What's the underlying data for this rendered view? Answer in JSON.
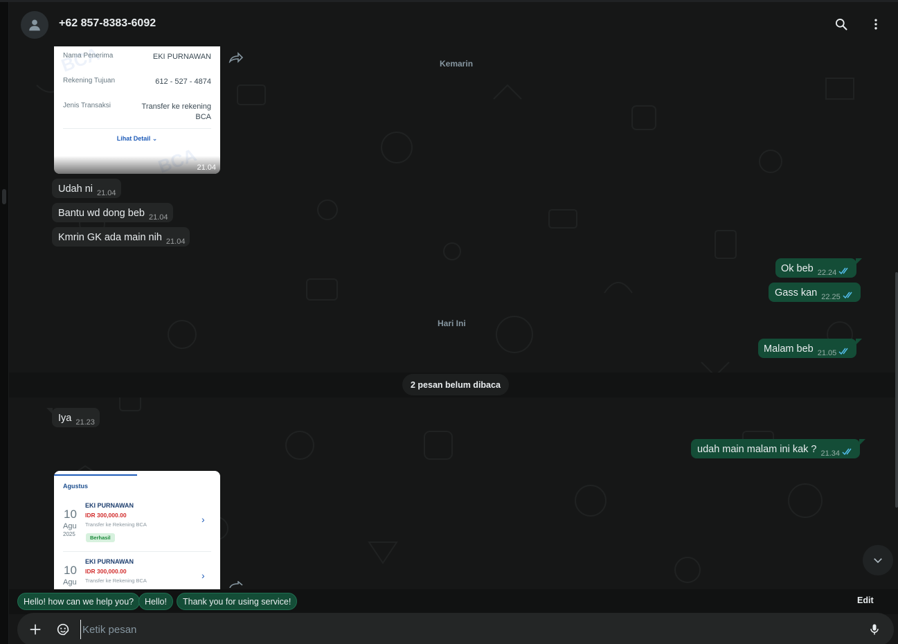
{
  "header": {
    "contact": "+62 857-8383-6092",
    "search_icon": "search-icon",
    "menu_icon": "more-vert-icon"
  },
  "receipt1": {
    "rows": [
      {
        "label": "Nama Penerima",
        "value": "EKI PURNAWAN"
      },
      {
        "label": "Rekening Tujuan",
        "value": "612 - 527 - 4874"
      },
      {
        "label": "Jenis Transaksi",
        "value_line1": "Transfer ke rekening",
        "value_line2": "BCA"
      }
    ],
    "detail_link": "Lihat Detail",
    "watermark": "BCA",
    "time": "21.04"
  },
  "dividers": {
    "yesterday": "Kemarin",
    "today": "Hari Ini",
    "unread": "2 pesan belum dibaca"
  },
  "messages": [
    {
      "dir": "in",
      "text": "Udah ni",
      "time": "21.04"
    },
    {
      "dir": "in",
      "text": "Bantu wd dong beb",
      "time": "21.04"
    },
    {
      "dir": "in",
      "text": "Kmrin GK ada main nih",
      "time": "21.04"
    },
    {
      "dir": "out",
      "text": "Ok beb",
      "time": "22.24",
      "status": "read"
    },
    {
      "dir": "out",
      "text": "Gass kan",
      "time": "22.25",
      "status": "read"
    },
    {
      "dir": "out",
      "text": "Malam beb",
      "time": "21.05",
      "status": "read"
    },
    {
      "dir": "in",
      "text": "Iya",
      "time": "21.23"
    },
    {
      "dir": "out",
      "text": "udah main malam ini kak ?",
      "time": "21.34",
      "status": "read"
    }
  ],
  "receipt2": {
    "month": "Agustus",
    "items": [
      {
        "day": "10",
        "mon": "Agu",
        "year": "2025",
        "name": "EKI PURNAWAN",
        "amount": "IDR 300,000.00",
        "desc": "Transfer ke Rekening BCA",
        "status": "Berhasil"
      },
      {
        "day": "10",
        "mon": "Agu",
        "name": "EKI PURNAWAN",
        "amount": "IDR 300,000.00",
        "desc": "Transfer ke Rekening BCA"
      }
    ]
  },
  "quick_replies": [
    "Hello! how can we help you?",
    "Hello!",
    "Thank you for using service!"
  ],
  "quick_edit": "Edit",
  "composer": {
    "placeholder": "Ketik pesan",
    "value": ""
  },
  "colors": {
    "outgoing": "#144d37",
    "incoming": "#242626",
    "read_ticks": "#53bdeb",
    "background": "#161717"
  }
}
